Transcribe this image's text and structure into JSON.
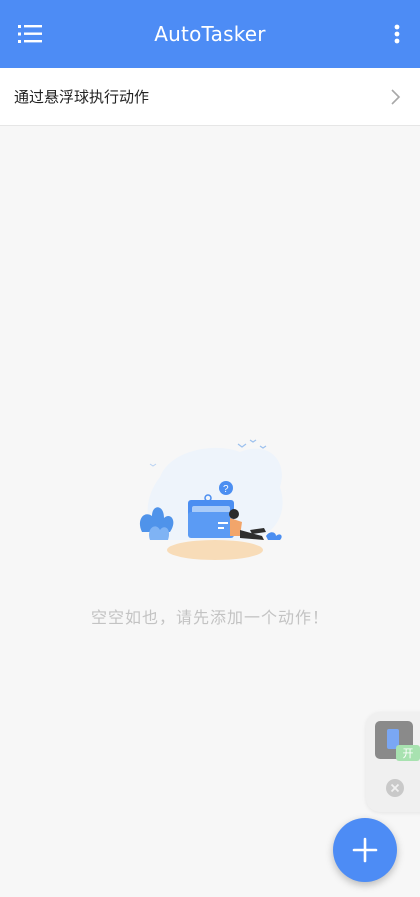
{
  "app": {
    "title": "AutoTasker",
    "accent_color": "#4d8cf5"
  },
  "topbar": {
    "menu_icon": "list-menu-icon",
    "more_icon": "more-vert-icon"
  },
  "list": {
    "items": [
      {
        "label": "通过悬浮球执行动作",
        "icon": "chevron-right-icon"
      }
    ]
  },
  "empty_state": {
    "illustration": "empty-folder-illustration",
    "message": "空空如也，请先添加一个动作！"
  },
  "floating_panel": {
    "thumbnail_icon": "floating-ball-icon",
    "badge": "开",
    "close_icon": "close-circle-icon"
  },
  "fab": {
    "icon": "plus-icon"
  }
}
